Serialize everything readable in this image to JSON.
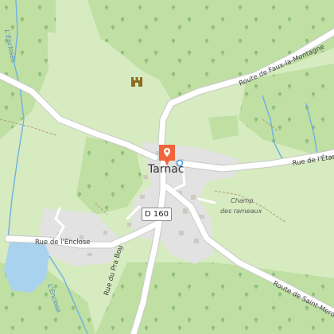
{
  "map": {
    "town": "Tarnac",
    "route_shield": "D 160",
    "roads": {
      "faux_la_montagne": "Route de Faux-la-Montagne",
      "etang": "Rue de l'Étang",
      "saint_merd": "Route de Saint-Merd-le",
      "pra_bou": "Rue du Pra Bou",
      "enclose_road": "Rue de l'Enclose"
    },
    "water": {
      "stream_north": "L'Enclose",
      "stream_south": "L'Enclose"
    },
    "places": {
      "champ_line1": "Champ",
      "champ_line2": "des rameaux"
    },
    "icons": {
      "poi_pin": "location-pin-icon",
      "castle": "castle-icon",
      "place_dot": "place-dot-icon"
    },
    "colors": {
      "meadow": "#d6ebc0",
      "forest": "#bfdfa3",
      "water": "#a9d2ef",
      "stream": "#6fb1e3",
      "urban": "#e2e2e2",
      "road": "#ffffff",
      "pin": "#f0643c"
    }
  }
}
